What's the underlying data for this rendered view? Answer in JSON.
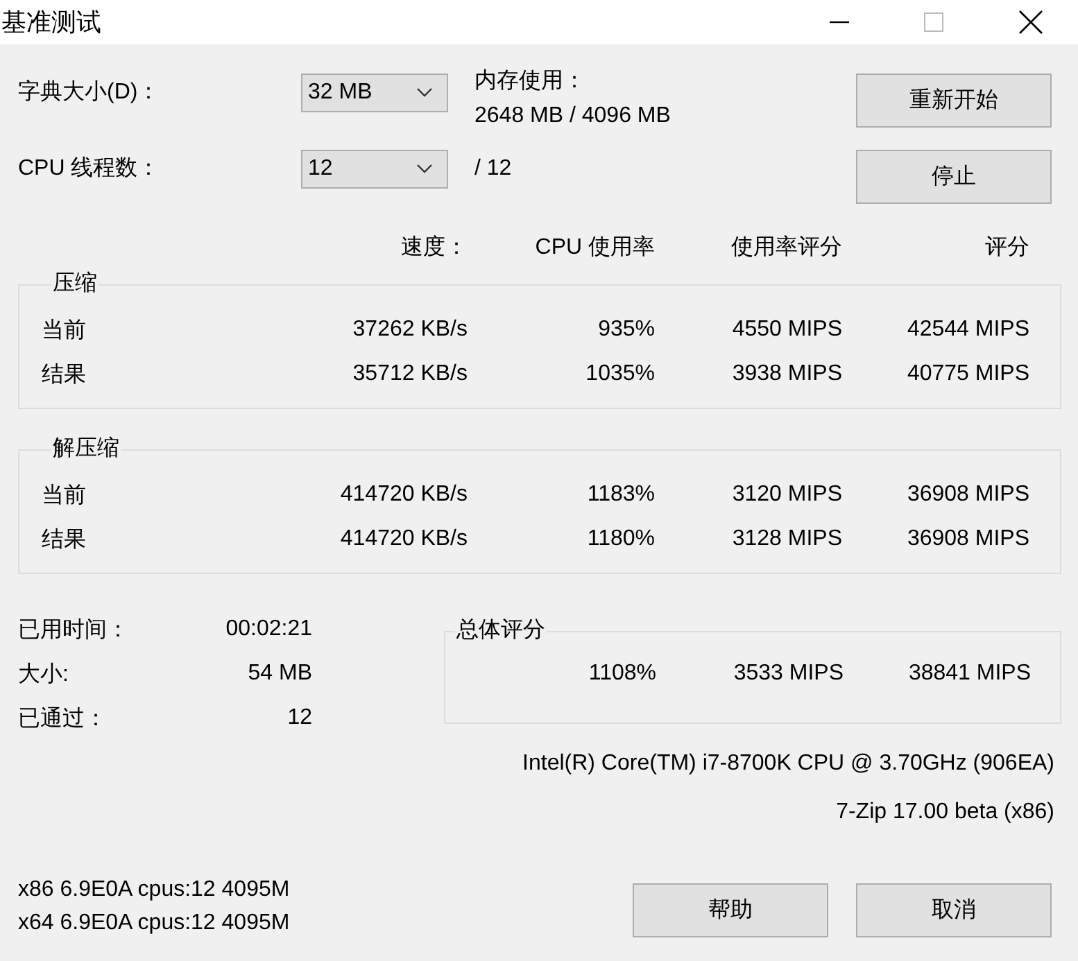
{
  "window": {
    "title": "基准测试"
  },
  "settings": [
    {
      "label": "字典大小(D)：",
      "value": "32 MB"
    },
    {
      "label": "CPU 线程数：",
      "value": "12"
    }
  ],
  "memory": {
    "label": "内存使用：",
    "value": "2648 MB / 4096 MB"
  },
  "threads_total": "/ 12",
  "buttons_top": [
    "重新开始",
    "停止"
  ],
  "columns": [
    "速度：",
    "CPU 使用率",
    "使用率评分",
    "评分"
  ],
  "groups": [
    {
      "title": "压缩",
      "rows": [
        {
          "label": "当前",
          "values": [
            "37262 KB/s",
            "935%",
            "4550 MIPS",
            "42544 MIPS"
          ]
        },
        {
          "label": "结果",
          "values": [
            "35712 KB/s",
            "1035%",
            "3938 MIPS",
            "40775 MIPS"
          ]
        }
      ]
    },
    {
      "title": "解压缩",
      "rows": [
        {
          "label": "当前",
          "values": [
            "414720 KB/s",
            "1183%",
            "3120 MIPS",
            "36908 MIPS"
          ]
        },
        {
          "label": "结果",
          "values": [
            "414720 KB/s",
            "1180%",
            "3128 MIPS",
            "36908 MIPS"
          ]
        }
      ]
    }
  ],
  "stats": [
    {
      "label": "已用时间：",
      "value": "00:02:21"
    },
    {
      "label": "大小:",
      "value": "54 MB"
    },
    {
      "label": "已通过：",
      "value": "12"
    }
  ],
  "total": {
    "title": "总体评分",
    "values": [
      "1108%",
      "3533 MIPS",
      "38841 MIPS"
    ]
  },
  "cpu_info": "Intel(R) Core(TM) i7-8700K CPU @ 3.70GHz (906EA)",
  "version": "7-Zip 17.00 beta (x86)",
  "system_lines": [
    "x86 6.9E0A cpus:12 4095M",
    "x64 6.9E0A cpus:12 4095M"
  ],
  "buttons_bottom": [
    "帮助",
    "取消"
  ]
}
